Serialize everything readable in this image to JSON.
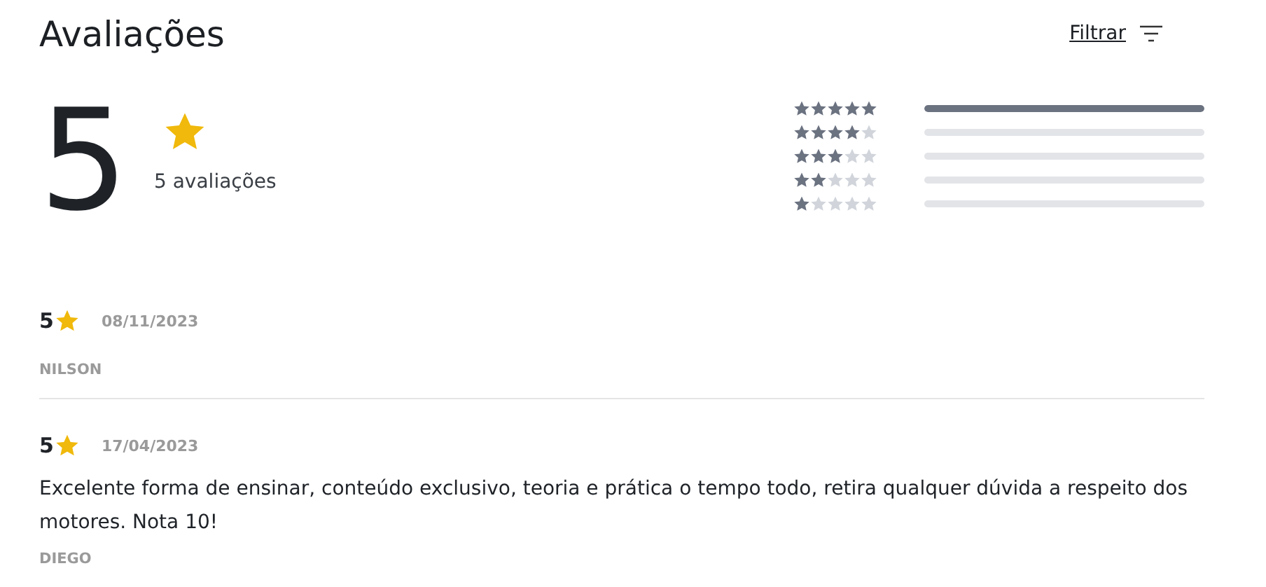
{
  "title": "Avaliações",
  "filter": {
    "label": "Filtrar"
  },
  "summary": {
    "average": "5",
    "count": "5 avaliações"
  },
  "distribution": [
    {
      "stars": 5,
      "level": 1
    },
    {
      "stars": 4,
      "level": 0
    },
    {
      "stars": 3,
      "level": 0
    },
    {
      "stars": 2,
      "level": 0
    },
    {
      "stars": 1,
      "level": 0
    }
  ],
  "reviews": [
    {
      "rating": "5",
      "date": "08/11/2023",
      "author": "NILSON"
    },
    {
      "rating": "5",
      "date": "17/04/2023",
      "comment": "Excelente forma de ensinar, conteúdo exclusivo, teoria e prática o tempo todo, retira qualquer dúvida a respeito dos motores. Nota 10!",
      "author": "DIEGO"
    }
  ]
}
